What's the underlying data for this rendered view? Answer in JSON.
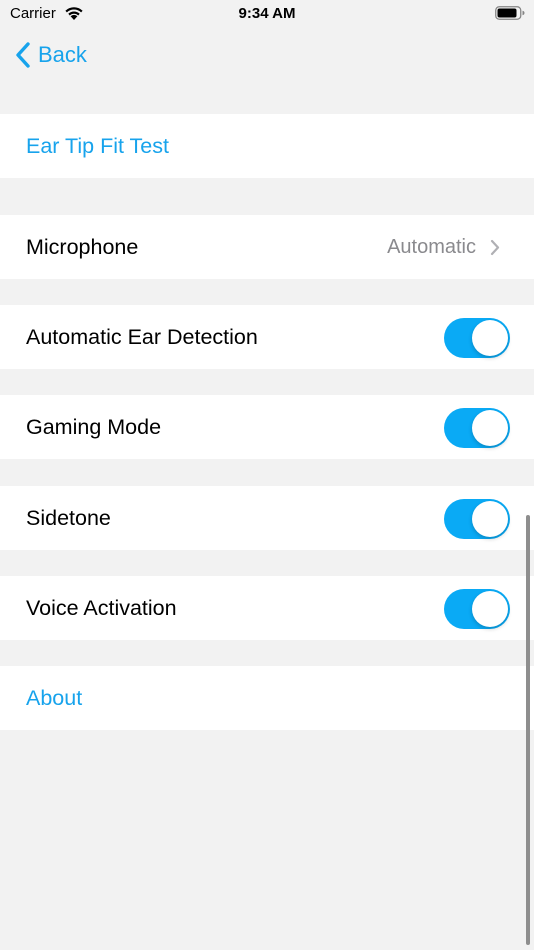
{
  "status_bar": {
    "carrier": "Carrier",
    "time": "9:34 AM",
    "wifi_icon": "wifi-icon",
    "battery_icon": "battery-icon"
  },
  "nav": {
    "back_label": "Back",
    "back_icon": "chevron-left-icon"
  },
  "rows": {
    "ear_tip": {
      "label": "Ear Tip Fit Test"
    },
    "microphone": {
      "label": "Microphone",
      "value": "Automatic",
      "icon": "chevron-right-icon"
    },
    "ear_detection": {
      "label": "Automatic Ear Detection",
      "on": true
    },
    "gaming_mode": {
      "label": "Gaming Mode",
      "on": true
    },
    "sidetone": {
      "label": "Sidetone",
      "on": true
    },
    "voice_activation": {
      "label": "Voice Activation",
      "on": true
    },
    "about": {
      "label": "About"
    }
  },
  "colors": {
    "accent": "#17a3ec",
    "toggle_on": "#0aaaf5",
    "background": "#f2f2f2",
    "secondary_text": "#8a8a8e"
  }
}
